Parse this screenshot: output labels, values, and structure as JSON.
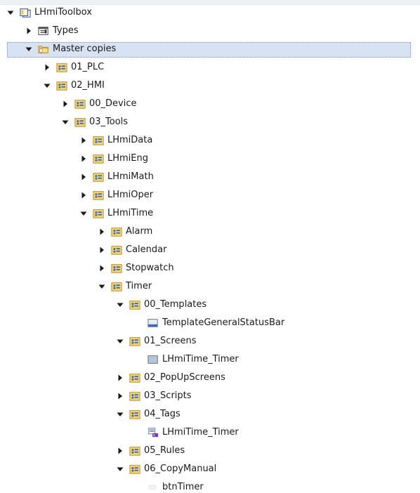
{
  "tree": [
    {
      "label": "LHmiToolbox",
      "icon": "project-library-icon",
      "toggle": "expanded",
      "depth": 0
    },
    {
      "label": "Types",
      "icon": "types-folder-icon",
      "toggle": "collapsed",
      "depth": 1
    },
    {
      "label": "Master copies",
      "icon": "master-copies-folder-icon",
      "toggle": "expanded",
      "depth": 1,
      "selected": true
    },
    {
      "label": "01_PLC",
      "icon": "master-copy-folder-icon",
      "toggle": "collapsed",
      "depth": 2
    },
    {
      "label": "02_HMI",
      "icon": "master-copy-folder-icon",
      "toggle": "expanded",
      "depth": 2
    },
    {
      "label": "00_Device",
      "icon": "master-copy-folder-icon",
      "toggle": "collapsed",
      "depth": 3
    },
    {
      "label": "03_Tools",
      "icon": "master-copy-folder-icon",
      "toggle": "expanded",
      "depth": 3
    },
    {
      "label": "LHmiData",
      "icon": "master-copy-folder-icon",
      "toggle": "collapsed",
      "depth": 4
    },
    {
      "label": "LHmiEng",
      "icon": "master-copy-folder-icon",
      "toggle": "collapsed",
      "depth": 4
    },
    {
      "label": "LHmiMath",
      "icon": "master-copy-folder-icon",
      "toggle": "collapsed",
      "depth": 4
    },
    {
      "label": "LHmiOper",
      "icon": "master-copy-folder-icon",
      "toggle": "collapsed",
      "depth": 4
    },
    {
      "label": "LHmiTime",
      "icon": "master-copy-folder-icon",
      "toggle": "expanded",
      "depth": 4
    },
    {
      "label": "Alarm",
      "icon": "master-copy-folder-icon",
      "toggle": "collapsed",
      "depth": 5
    },
    {
      "label": "Calendar",
      "icon": "master-copy-folder-icon",
      "toggle": "collapsed",
      "depth": 5
    },
    {
      "label": "Stopwatch",
      "icon": "master-copy-folder-icon",
      "toggle": "collapsed",
      "depth": 5
    },
    {
      "label": "Timer",
      "icon": "master-copy-folder-icon",
      "toggle": "expanded",
      "depth": 5
    },
    {
      "label": "00_Templates",
      "icon": "master-copy-folder-icon",
      "toggle": "expanded",
      "depth": 6
    },
    {
      "label": "TemplateGeneralStatusBar",
      "icon": "template-screen-icon",
      "toggle": "none",
      "depth": 7
    },
    {
      "label": "01_Screens",
      "icon": "master-copy-folder-icon",
      "toggle": "expanded",
      "depth": 6
    },
    {
      "label": "LHmiTime_Timer",
      "icon": "screen-icon",
      "toggle": "none",
      "depth": 7
    },
    {
      "label": "02_PopUpScreens",
      "icon": "master-copy-folder-icon",
      "toggle": "collapsed",
      "depth": 6
    },
    {
      "label": "03_Scripts",
      "icon": "master-copy-folder-icon",
      "toggle": "collapsed",
      "depth": 6
    },
    {
      "label": "04_Tags",
      "icon": "master-copy-folder-icon",
      "toggle": "expanded",
      "depth": 6
    },
    {
      "label": "LHmiTime_Timer",
      "icon": "tag-table-icon",
      "toggle": "none",
      "depth": 7
    },
    {
      "label": "05_Rules",
      "icon": "master-copy-folder-icon",
      "toggle": "collapsed",
      "depth": 6
    },
    {
      "label": "06_CopyManual",
      "icon": "master-copy-folder-icon",
      "toggle": "expanded",
      "depth": 6
    },
    {
      "label": "btnTimer",
      "icon": "button-object-icon",
      "toggle": "none",
      "depth": 7
    }
  ]
}
